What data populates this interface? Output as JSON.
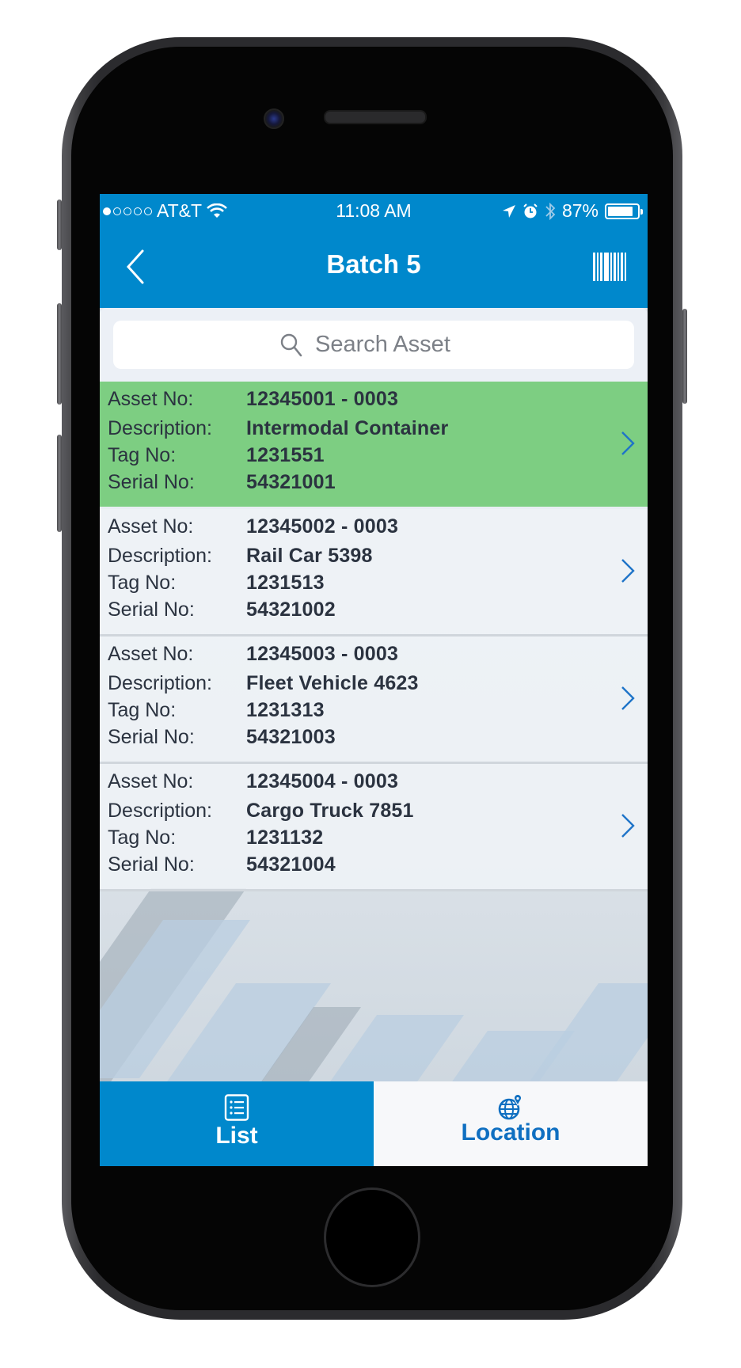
{
  "status_bar": {
    "signal_bars_filled": 1,
    "signal_bars_total": 5,
    "carrier": "AT&T",
    "time": "11:08 AM",
    "battery_percent_label": "87%",
    "battery_level": 0.87,
    "icons": [
      "wifi-icon",
      "location-arrow-icon",
      "alarm-icon",
      "bluetooth-icon",
      "battery-icon"
    ]
  },
  "nav_bar": {
    "title": "Batch 5",
    "back_icon": "chevron-left-icon",
    "action_icon": "barcode-icon"
  },
  "search": {
    "placeholder": "Search Asset",
    "value": "",
    "icon": "search-icon"
  },
  "labels": {
    "asset_no": "Asset No:",
    "description": "Description:",
    "tag_no": "Tag No:",
    "serial_no": "Serial No:"
  },
  "assets": [
    {
      "asset_no": "12345001 - 0003",
      "description": "Intermodal Container",
      "tag_no": "1231551",
      "serial_no": "54321001",
      "selected": true
    },
    {
      "asset_no": "12345002 - 0003",
      "description": "Rail Car 5398",
      "tag_no": "1231513",
      "serial_no": "54321002",
      "selected": false
    },
    {
      "asset_no": "12345003 - 0003",
      "description": "Fleet Vehicle 4623",
      "tag_no": "1231313",
      "serial_no": "54321003",
      "selected": false
    },
    {
      "asset_no": "12345004 - 0003",
      "description": "Cargo Truck 7851",
      "tag_no": "1231132",
      "serial_no": "54321004",
      "selected": false
    }
  ],
  "tabs": [
    {
      "label": "List",
      "icon": "list-icon",
      "active": true
    },
    {
      "label": "Location",
      "icon": "globe-pin-icon",
      "active": false
    }
  ],
  "colors": {
    "primary": "#0088cc",
    "selected_row": "#7dce82",
    "inactive_tab_text": "#0f6fc1"
  }
}
